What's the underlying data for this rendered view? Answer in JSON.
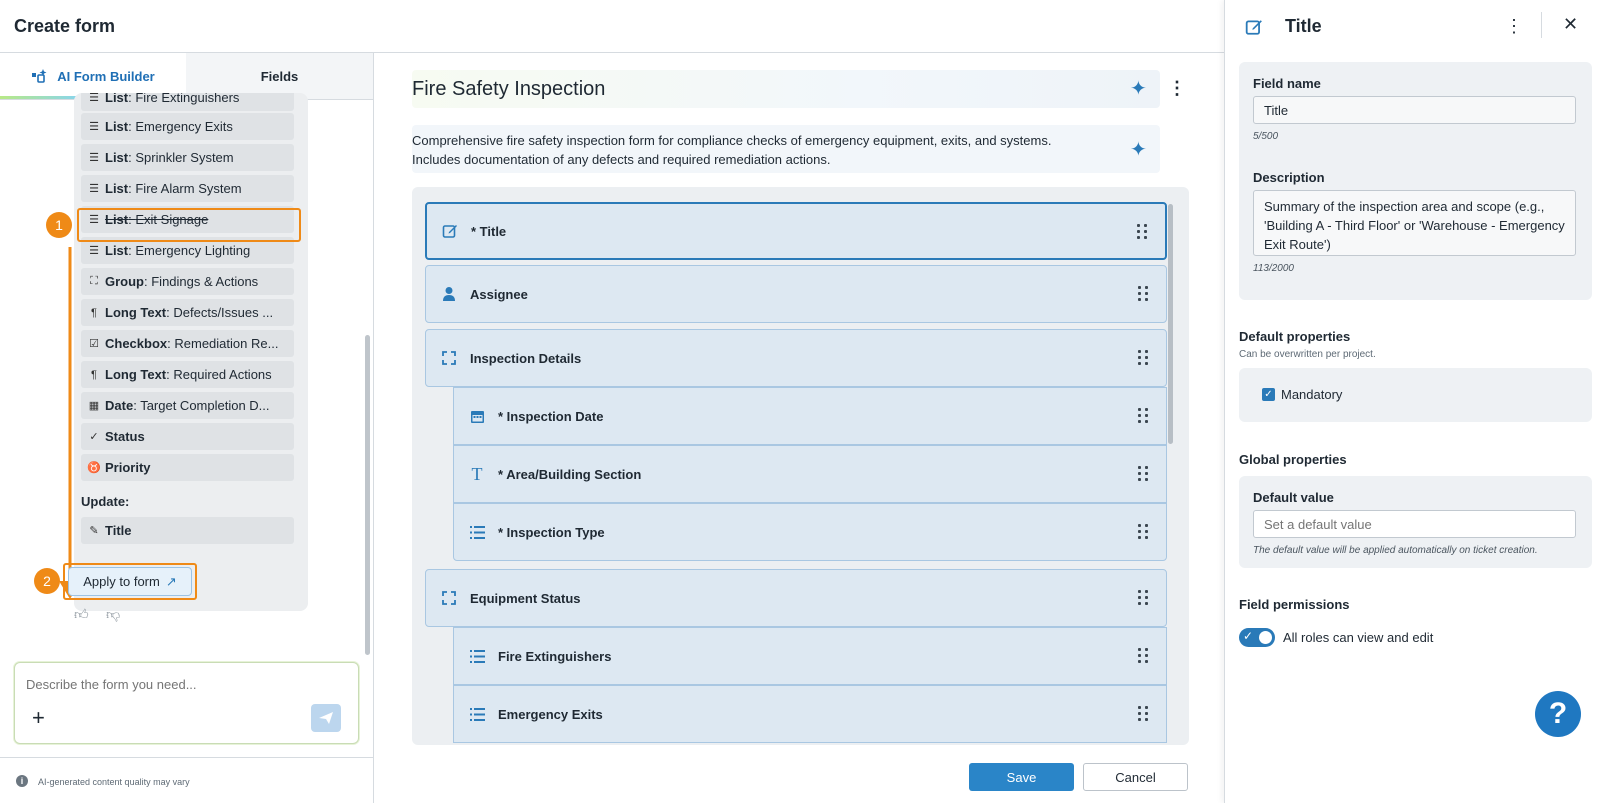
{
  "header": {
    "title": "Create form"
  },
  "left_panel": {
    "tabs": {
      "ai_builder": "AI Form Builder",
      "fields": "Fields"
    },
    "suggestions": [
      {
        "type": "List",
        "name": "Fire Extinguishers"
      },
      {
        "type": "List",
        "name": "Emergency Exits"
      },
      {
        "type": "List",
        "name": "Sprinkler System"
      },
      {
        "type": "List",
        "name": "Fire Alarm System"
      },
      {
        "type": "List",
        "name": "Exit Signage"
      },
      {
        "type": "List",
        "name": "Emergency Lighting"
      },
      {
        "type": "Group",
        "name": "Findings & Actions"
      },
      {
        "type": "Long Text",
        "name": "Defects/Issues ..."
      },
      {
        "type": "Checkbox",
        "name": "Remediation Re..."
      },
      {
        "type": "Long Text",
        "name": "Required Actions"
      },
      {
        "type": "Date",
        "name": "Target Completion D..."
      },
      {
        "type": "",
        "name": "Status"
      },
      {
        "type": "",
        "name": "Priority"
      }
    ],
    "update_label": "Update:",
    "update_item": "Title",
    "badges": {
      "first": "1",
      "second": "2"
    },
    "apply_button": "Apply to form",
    "prompt_placeholder": "Describe the form you need...",
    "plus": "+",
    "footer_note": "AI-generated content quality may vary"
  },
  "form": {
    "title": "Fire Safety Inspection",
    "description": "Comprehensive fire safety inspection form for compliance checks of emergency equipment, exits, and systems. Includes documentation of any defects and required remediation actions.",
    "fields": [
      {
        "label": "* Title",
        "icon": "edit-icon"
      },
      {
        "label": "Assignee",
        "icon": "person-icon"
      },
      {
        "label": "Inspection Details",
        "icon": "group-icon"
      },
      {
        "label": "* Inspection Date",
        "icon": "calendar-icon"
      },
      {
        "label": "* Area/Building Section",
        "icon": "text-icon"
      },
      {
        "label": "* Inspection Type",
        "icon": "list-icon"
      },
      {
        "label": "Equipment Status",
        "icon": "group-icon"
      },
      {
        "label": "Fire Extinguishers",
        "icon": "list-icon"
      },
      {
        "label": "Emergency Exits",
        "icon": "list-icon"
      }
    ],
    "save": "Save",
    "cancel": "Cancel"
  },
  "right_panel": {
    "title": "Title",
    "field_name_label": "Field name",
    "field_name_value": "Title",
    "field_name_counter": "5/500",
    "description_label": "Description",
    "description_value": "Summary of the inspection area and scope (e.g., 'Building A - Third Floor' or 'Warehouse - Emergency Exit Route')",
    "description_counter": "113/2000",
    "default_props_heading": "Default properties",
    "default_props_sub": "Can be overwritten per project.",
    "mandatory_label": "Mandatory",
    "mandatory_checked": true,
    "global_props_heading": "Global properties",
    "default_value_label": "Default value",
    "default_value_placeholder": "Set a default value",
    "default_value_hint": "The default value will be applied automatically on ticket creation.",
    "permissions_heading": "Field permissions",
    "permissions_label": "All roles can view and edit",
    "permissions_enabled": true
  },
  "help": {
    "label": "?"
  },
  "colors": {
    "accent": "#2a7ab8",
    "highlight": "#ef8a17",
    "primary_button": "#2a85c8"
  }
}
